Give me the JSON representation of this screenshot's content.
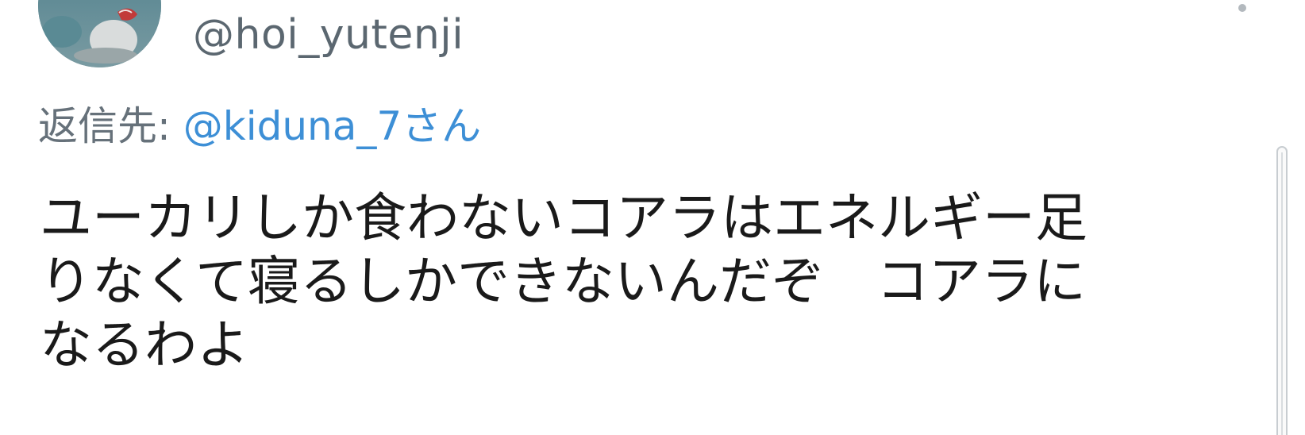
{
  "tweet": {
    "handle": "@hoi_yutenji",
    "reply": {
      "label": "返信先:",
      "target": "@kiduna_7さん"
    },
    "text_lines": [
      "ユーカリしか食わないコアラはエネルギー足",
      "りなくて寝るしかできないんだぞ　コアラに",
      "なるわよ"
    ]
  },
  "icons": {
    "avatar": "profile-photo",
    "menu": "more-dot-icon"
  },
  "colors": {
    "link": "#3d8fd6",
    "secondary_text": "#5b6770",
    "text": "#1a1a1a"
  }
}
